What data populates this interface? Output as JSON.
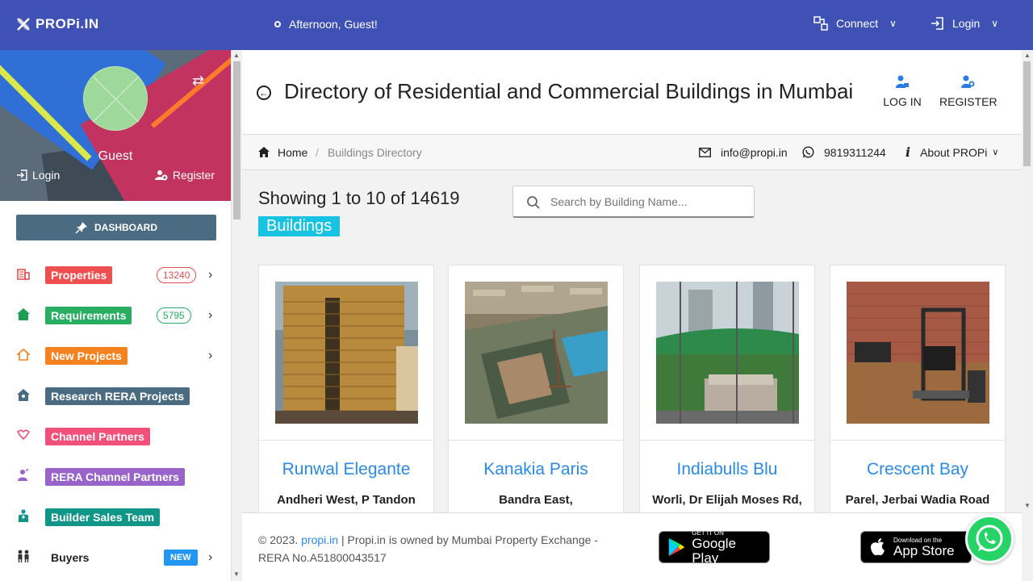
{
  "header": {
    "brand": "PROPi.IN",
    "greeting": "Afternoon, Guest!",
    "connect_label": "Connect",
    "login_label": "Login"
  },
  "sidebar": {
    "guest_name": "Guest",
    "login_label": "Login",
    "register_label": "Register",
    "dashboard_label": "DASHBOARD",
    "items": [
      {
        "label": "Properties",
        "color": "#ef4f4f",
        "icon_color": "#e05050",
        "icon": "building-icon",
        "badge": "13240",
        "badge_color": "#e05050",
        "has_chevron": true
      },
      {
        "label": "Requirements",
        "color": "#27ae60",
        "icon_color": "#1e9e55",
        "icon": "home-icon",
        "badge": "5795",
        "badge_color": "#27ae60",
        "has_chevron": true
      },
      {
        "label": "New Projects",
        "color": "#f5821f",
        "icon_color": "#f5821f",
        "icon": "house-outline-icon",
        "badge": "",
        "has_chevron": true
      },
      {
        "label": "Research RERA Projects",
        "color": "#4a6b82",
        "icon_color": "#4a6b82",
        "icon": "house-search-icon",
        "badge": "",
        "has_chevron": false
      },
      {
        "label": "Channel Partners",
        "color": "#f0507a",
        "icon_color": "#f0507a",
        "icon": "handshake-icon",
        "badge": "",
        "has_chevron": false
      },
      {
        "label": "RERA Channel Partners",
        "color": "#9a63c9",
        "icon_color": "#9a63c9",
        "icon": "person-badge-icon",
        "badge": "",
        "has_chevron": false
      },
      {
        "label": "Builder Sales Team",
        "color": "#0f9688",
        "icon_color": "#0f9688",
        "icon": "team-icon",
        "badge": "",
        "has_chevron": false
      },
      {
        "label": "Buyers",
        "color": "",
        "icon_color": "#333333",
        "icon": "people-icon",
        "badge": "NEW",
        "has_chevron": true
      }
    ]
  },
  "main": {
    "title": "Directory of Residential and Commercial Buildings in Mumbai",
    "log_in_label": "LOG IN",
    "register_label": "REGISTER",
    "breadcrumb": {
      "home": "Home",
      "separator": "/",
      "current": "Buildings Directory"
    },
    "email": "info@propi.in",
    "phone": "9819311244",
    "about_label": "About PROPi",
    "showing_text": "Showing 1 to 10 of 14619",
    "buildings_tag": "Buildings",
    "search_placeholder": "Search by Building Name...",
    "cards": [
      {
        "name": "Runwal Elegante",
        "address": "Andheri West, P Tandon"
      },
      {
        "name": "Kanakia Paris",
        "address": "Bandra East,"
      },
      {
        "name": "Indiabulls Blu",
        "address": "Worli, Dr Elijah Moses Rd,"
      },
      {
        "name": "Crescent Bay",
        "address": "Parel, Jerbai Wadia Road"
      }
    ]
  },
  "footer": {
    "copyright_prefix": "© 2023.",
    "site_link": "propi.in",
    "copyright_rest": "| Propi.in is owned by Mumbai Property Exchange - RERA No.A51800043517",
    "google_play_small": "GET IT ON",
    "google_play_big": "Google Play",
    "app_store_small": "Download on the",
    "app_store_big": "App Store"
  }
}
